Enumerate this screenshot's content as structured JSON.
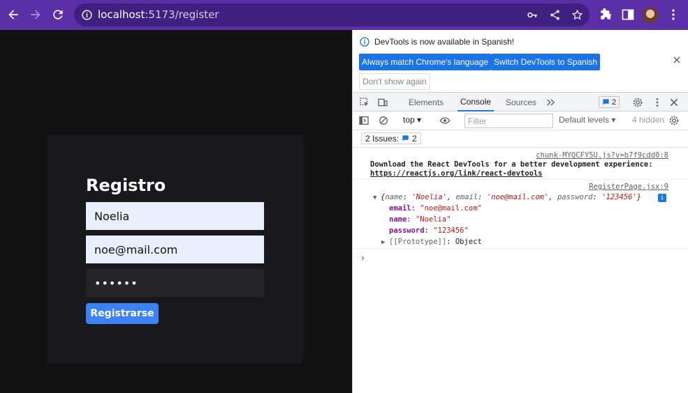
{
  "browser": {
    "url_host": "localhost",
    "url_path": ":5173/register"
  },
  "app": {
    "title": "Registro",
    "name_value": "Noelia",
    "email_value": "noe@mail.com",
    "password_mask": "••••••",
    "submit_label": "Registrarse"
  },
  "devtools": {
    "banner": {
      "message": "DevTools is now available in Spanish!",
      "btn_match": "Always match Chrome's language",
      "btn_switch": "Switch DevTools to Spanish",
      "btn_dont_show": "Don't show again"
    },
    "tabs": [
      "Elements",
      "Console",
      "Sources"
    ],
    "active_tab": "Console",
    "message_count": "2",
    "toolbar": {
      "context": "top",
      "filter_placeholder": "Filter",
      "levels": "Default levels",
      "hidden": "4 hidden"
    },
    "issues": {
      "label": "2 Issues:",
      "count": "2"
    },
    "logs": [
      {
        "source": "chunk-MYQCFY5U.js?v=b7f9cdd0:8",
        "line1": "Download the React DevTools for a better development experience:",
        "line2": "https://reactjs.org/link/react-devtools"
      },
      {
        "source": "RegisterPage.jsx:9",
        "summary": {
          "name_key": "name",
          "name_val": "'Noelia'",
          "email_key": "email",
          "email_val": "'noe@mail.com'",
          "password_key": "password",
          "password_val": "'123456'"
        },
        "props": [
          {
            "key": "email",
            "value": "\"noe@mail.com\""
          },
          {
            "key": "name",
            "value": "\"Noelia\""
          },
          {
            "key": "password",
            "value": "\"123456\""
          }
        ],
        "prototype": "[[Prototype]]",
        "prototype_value": "Object"
      }
    ]
  },
  "colors": {
    "topbar": "#5b30a6",
    "accent": "#3b82f6",
    "devtools_blue": "#1a73e8"
  }
}
